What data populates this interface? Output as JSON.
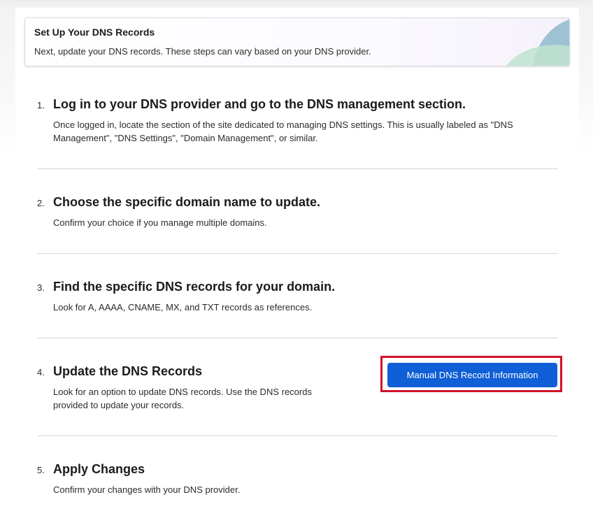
{
  "banner": {
    "title": "Set Up Your DNS Records",
    "subtitle": "Next, update your DNS records. These steps can vary based on your DNS provider."
  },
  "steps": [
    {
      "number": "1.",
      "title": "Log in to your DNS provider and go to the DNS management section.",
      "description": "Once logged in, locate the section of the site dedicated to managing DNS settings. This is usually labeled as \"DNS Management\", \"DNS Settings\", \"Domain Management\", or similar."
    },
    {
      "number": "2.",
      "title": "Choose the specific domain name to update.",
      "description": "Confirm your choice if you manage multiple domains."
    },
    {
      "number": "3.",
      "title": "Find the specific DNS records for your domain.",
      "description": "Look for A, AAAA, CNAME, MX, and TXT records as references."
    },
    {
      "number": "4.",
      "title": "Update the DNS Records",
      "description": "Look for an option to update DNS records. Use the DNS records provided to update your records.",
      "button_label": "Manual DNS Record Information"
    },
    {
      "number": "5.",
      "title": "Apply Changes",
      "description": "Confirm your changes with your DNS provider."
    }
  ],
  "colors": {
    "primary_button": "#0f5fd6",
    "highlight_border": "#d0112b",
    "banner_accent_blue": "#8fb8cc",
    "banner_accent_green": "#bfe3cf"
  }
}
